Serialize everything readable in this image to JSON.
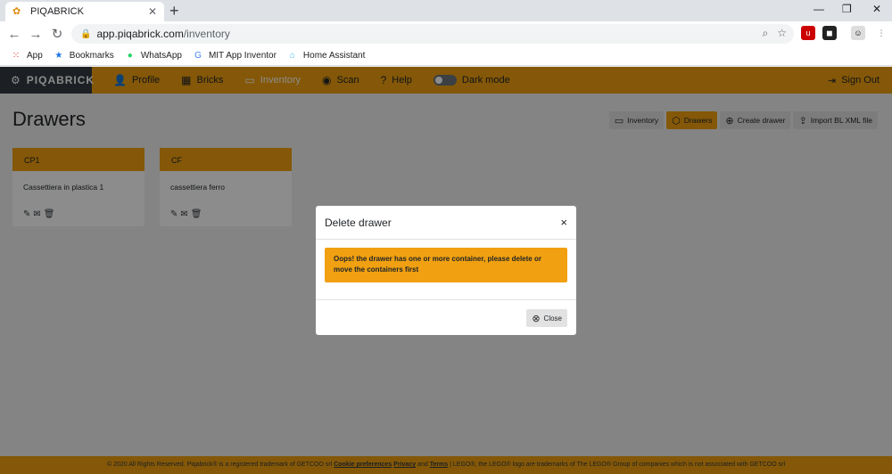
{
  "browser": {
    "tab_title": "PIQABRICK",
    "url_host": "app.piqabrick.com",
    "url_path": "/inventory",
    "bookmarks": [
      "App",
      "Bookmarks",
      "WhatsApp",
      "MIT App Inventor",
      "Home Assistant"
    ]
  },
  "nav": {
    "brand": "PIQABRICK",
    "items": [
      "Profile",
      "Bricks",
      "Inventory",
      "Scan",
      "Help"
    ],
    "dark_mode_label": "Dark mode",
    "sign_out": "Sign Out"
  },
  "page": {
    "title": "Drawers",
    "toolbar": [
      "Inventory",
      "Drawers",
      "Create drawer",
      "Import BL XML file"
    ]
  },
  "drawers": [
    {
      "code": "CP1",
      "name": "Cassettiera in plastica 1"
    },
    {
      "code": "CF",
      "name": "cassettiera ferro"
    }
  ],
  "modal": {
    "title": "Delete drawer",
    "close_x": "×",
    "message": "Oops! the drawer has one or more container, please delete or move the containers first",
    "close_label": "Close"
  },
  "footer": {
    "text1": "© 2020 All Rights Reserved. Piqabrick® is a registered trademark of GETCOO srl",
    "link1": "Cookie preferences",
    "link2": "Privacy",
    "and": "and",
    "link3": "Terms",
    "text2": "| LEGO®, the LEGO® logo are trademarks of The LEGO® Group of companies which is not associated with GETCOO srl"
  },
  "colors": {
    "accent": "#f0a010",
    "brand_bg": "#343a40"
  }
}
